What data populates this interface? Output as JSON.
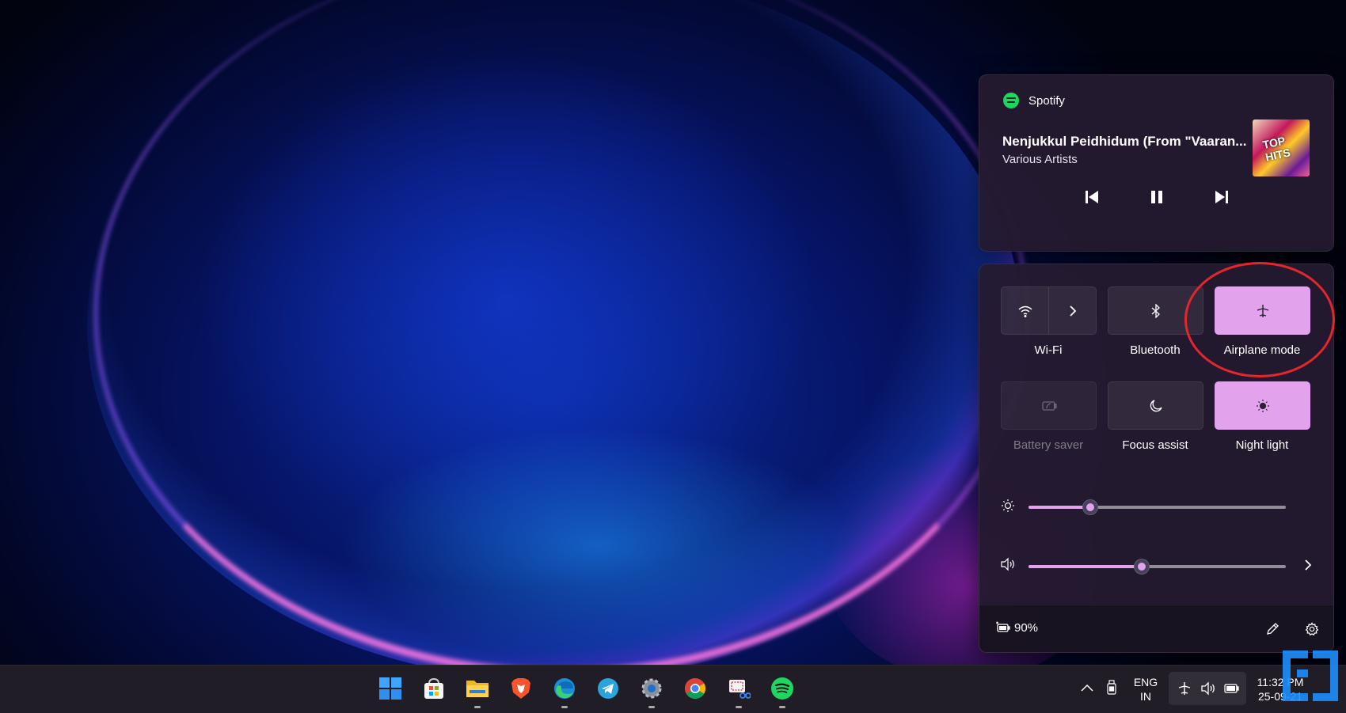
{
  "media": {
    "app_name": "Spotify",
    "track_title": "Nenjukkul Peidhidum (From \"Vaaran...",
    "artist": "Various Artists",
    "album_art_text": "TOP HITS",
    "controls": [
      "previous-icon",
      "pause-icon",
      "next-icon"
    ]
  },
  "quick_settings": {
    "tiles": [
      {
        "label": "Wi-Fi",
        "icon": "wifi-icon",
        "active": false
      },
      {
        "label": "Bluetooth",
        "icon": "bluetooth-icon",
        "active": false
      },
      {
        "label": "Airplane mode",
        "icon": "airplane-icon",
        "active": true
      },
      {
        "label": "Battery saver",
        "icon": "battery-saver-icon",
        "active": false,
        "disabled": true
      },
      {
        "label": "Focus assist",
        "icon": "moon-icon",
        "active": false
      },
      {
        "label": "Night light",
        "icon": "night-light-icon",
        "active": true
      }
    ],
    "brightness_level": 0.24,
    "volume_level": 0.44,
    "battery_percent": "90%"
  },
  "taskbar": {
    "apps": [
      "start",
      "microsoft-store",
      "file-explorer",
      "brave",
      "edge",
      "telegram",
      "settings",
      "chrome",
      "snipping-tool",
      "spotify"
    ],
    "language_line1": "ENG",
    "language_line2": "IN",
    "time": "11:32 PM",
    "date": "25-09-21"
  },
  "colors": {
    "accent": "#e2a2ec",
    "panel": "#241a30",
    "highlight_circle": "#e3262d"
  }
}
